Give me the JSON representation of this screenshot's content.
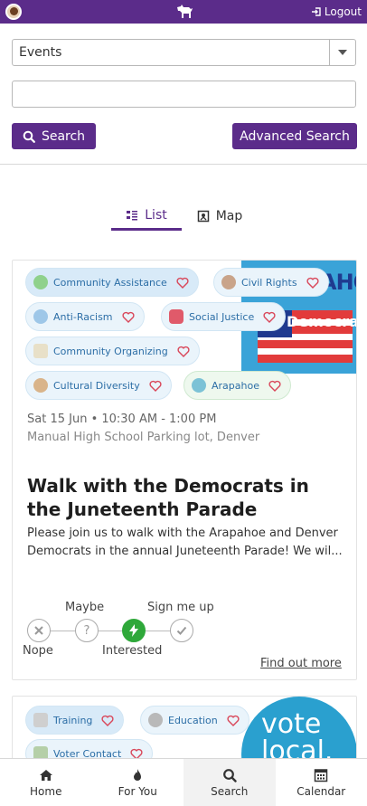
{
  "header": {
    "logout_label": "Logout"
  },
  "filters": {
    "type_select_value": "Events",
    "search_value": "",
    "search_label": "Search",
    "advanced_search_label": "Advanced Search"
  },
  "view_tabs": {
    "list_label": "List",
    "map_label": "Map"
  },
  "events": [
    {
      "tags": [
        "Community Assistance",
        "Civil Rights",
        "Anti-Racism",
        "Social Justice",
        "Community Organizing",
        "Cultural Diversity",
        "Arapahoe"
      ],
      "image_text": [
        "ARAPAHOE",
        "Democrats"
      ],
      "date": "Sat 15 Jun • 10:30 AM - 1:00 PM",
      "location": "Manual High School Parking lot, Denver",
      "title": "Walk with the Democrats in the Juneteenth Parade",
      "description": "Please join us to walk with the Arapahoe and Denver Democrats in the annual Juneteenth Parade! We wil...",
      "rsvp": {
        "nope": "Nope",
        "maybe": "Maybe",
        "interested": "Interested",
        "sign_me_up": "Sign me up",
        "selected": "Interested"
      },
      "find_out_more": "Find out more"
    },
    {
      "tags": [
        "Training",
        "Education",
        "Voter Contact"
      ],
      "image_text": "vote local."
    }
  ],
  "bottom_nav": {
    "home": "Home",
    "for_you": "For You",
    "search": "Search",
    "calendar": "Calendar",
    "active": "Search"
  },
  "colors": {
    "brand_purple": "#5b2c8a",
    "chip_text": "#2c6ea6",
    "interested_green": "#2fa83a"
  }
}
